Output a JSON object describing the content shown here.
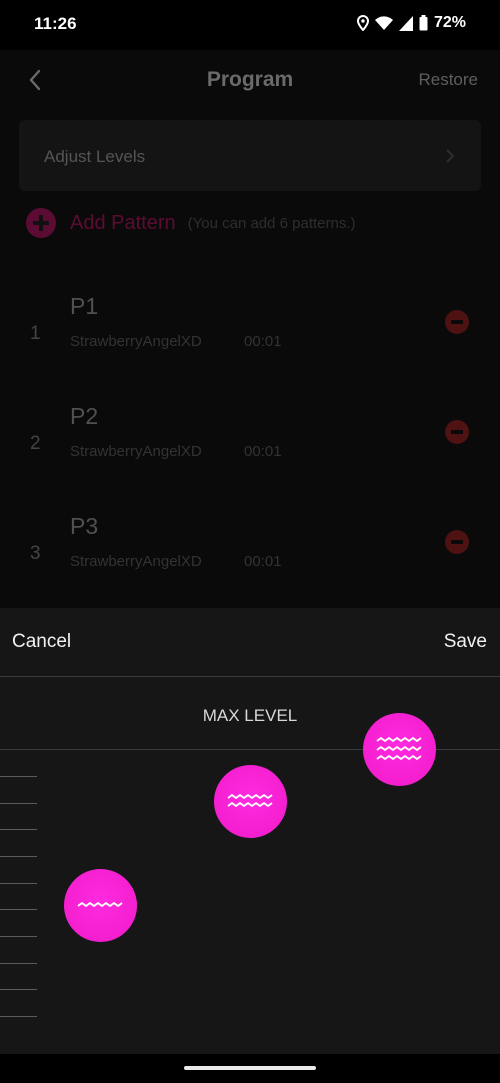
{
  "status_bar": {
    "time": "11:26",
    "battery": "72%"
  },
  "header": {
    "title": "Program",
    "action": "Restore"
  },
  "adjust_levels": {
    "label": "Adjust Levels"
  },
  "add_pattern": {
    "label": "Add Pattern",
    "hint": "(You can add 6 patterns.)"
  },
  "patterns": [
    {
      "index": "1",
      "name": "P1",
      "author": "StrawberryAngelXD",
      "duration": "00:01"
    },
    {
      "index": "2",
      "name": "P2",
      "author": "StrawberryAngelXD",
      "duration": "00:01"
    },
    {
      "index": "3",
      "name": "P3",
      "author": "StrawberryAngelXD",
      "duration": "00:01"
    }
  ],
  "sheet": {
    "cancel": "Cancel",
    "save": "Save",
    "max_level_label": "MAX LEVEL",
    "knobs": [
      {
        "icon": "wave-low-icon",
        "waves": 1
      },
      {
        "icon": "wave-medium-icon",
        "waves": 2
      },
      {
        "icon": "wave-high-icon",
        "waves": 3
      }
    ]
  },
  "colors": {
    "accent": "#f41fcf",
    "accent_dim": "#5c0c33",
    "remove": "#4e1212"
  }
}
